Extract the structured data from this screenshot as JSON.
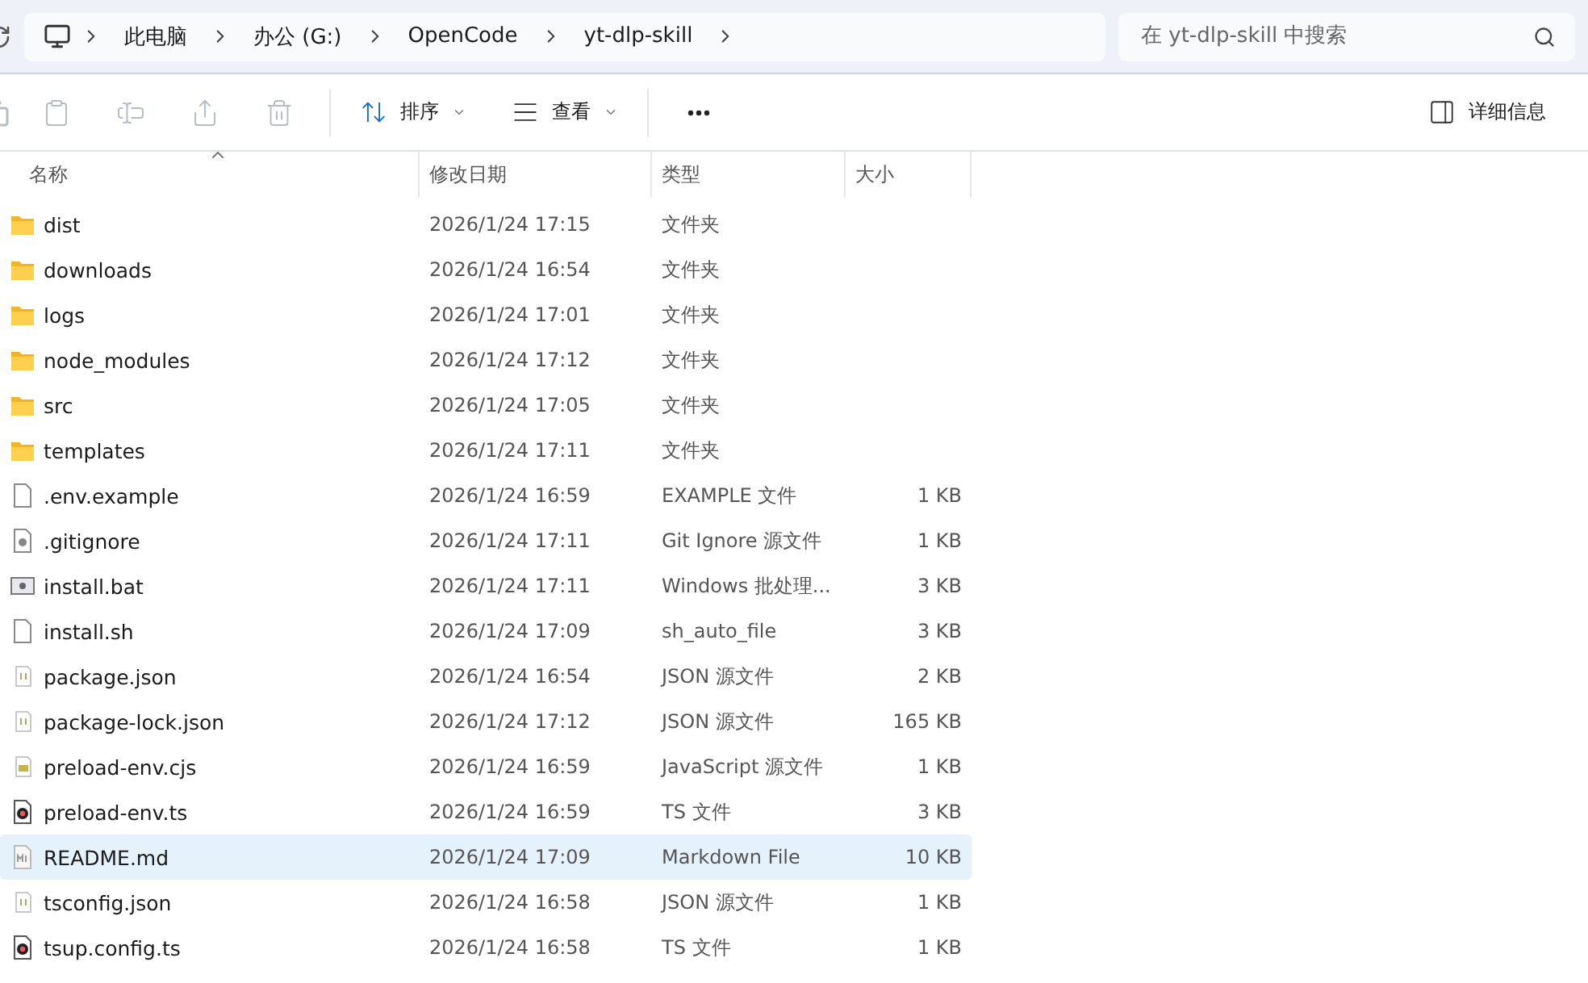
{
  "breadcrumb": [
    "此电脑",
    "办公 (G:)",
    "OpenCode",
    "yt-dlp-skill"
  ],
  "search": {
    "placeholder": "在 yt-dlp-skill 中搜索"
  },
  "toolbar": {
    "actions": [
      {
        "kind": "paste",
        "disabled": true
      },
      {
        "kind": "rename",
        "disabled": true
      },
      {
        "kind": "share",
        "disabled": true
      },
      {
        "kind": "delete",
        "disabled": true
      }
    ],
    "sort": "排序",
    "view": "查看",
    "details": "详细信息"
  },
  "table": {
    "columns": [
      "名称",
      "修改日期",
      "类型",
      "大小"
    ],
    "rows": [
      {
        "kind": "folder",
        "name": "dist",
        "date": "2026/1/24 17:15",
        "type": "文件夹",
        "size": "",
        "selected": false
      },
      {
        "kind": "folder",
        "name": "downloads",
        "date": "2026/1/24 16:54",
        "type": "文件夹",
        "size": "",
        "selected": false
      },
      {
        "kind": "folder",
        "name": "logs",
        "date": "2026/1/24 17:01",
        "type": "文件夹",
        "size": "",
        "selected": false
      },
      {
        "kind": "folder",
        "name": "node_modules",
        "date": "2026/1/24 17:12",
        "type": "文件夹",
        "size": "",
        "selected": false
      },
      {
        "kind": "folder",
        "name": "src",
        "date": "2026/1/24 17:05",
        "type": "文件夹",
        "size": "",
        "selected": false
      },
      {
        "kind": "folder",
        "name": "templates",
        "date": "2026/1/24 17:11",
        "type": "文件夹",
        "size": "",
        "selected": false
      },
      {
        "kind": "file",
        "name": ".env.example",
        "date": "2026/1/24 16:59",
        "type": "EXAMPLE 文件",
        "size": "1 KB",
        "selected": false
      },
      {
        "kind": "config",
        "name": ".gitignore",
        "date": "2026/1/24 17:11",
        "type": "Git Ignore 源文件",
        "size": "1 KB",
        "selected": false
      },
      {
        "kind": "batch",
        "name": "install.bat",
        "date": "2026/1/24 17:11",
        "type": "Windows 批处理...",
        "size": "3 KB",
        "selected": false
      },
      {
        "kind": "file",
        "name": "install.sh",
        "date": "2026/1/24 17:09",
        "type": "sh_auto_file",
        "size": "3 KB",
        "selected": false
      },
      {
        "kind": "json",
        "name": "package.json",
        "date": "2026/1/24 16:54",
        "type": "JSON 源文件",
        "size": "2 KB",
        "selected": false
      },
      {
        "kind": "json",
        "name": "package-lock.json",
        "date": "2026/1/24 17:12",
        "type": "JSON 源文件",
        "size": "165 KB",
        "selected": false
      },
      {
        "kind": "js",
        "name": "preload-env.cjs",
        "date": "2026/1/24 16:59",
        "type": "JavaScript 源文件",
        "size": "1 KB",
        "selected": false
      },
      {
        "kind": "ts",
        "name": "preload-env.ts",
        "date": "2026/1/24 16:59",
        "type": "TS 文件",
        "size": "3 KB",
        "selected": false
      },
      {
        "kind": "markdown",
        "name": "README.md",
        "date": "2026/1/24 17:09",
        "type": "Markdown File",
        "size": "10 KB",
        "selected": true
      },
      {
        "kind": "json",
        "name": "tsconfig.json",
        "date": "2026/1/24 16:58",
        "type": "JSON 源文件",
        "size": "1 KB",
        "selected": false
      },
      {
        "kind": "ts",
        "name": "tsup.config.ts",
        "date": "2026/1/24 16:58",
        "type": "TS 文件",
        "size": "1 KB",
        "selected": false
      }
    ]
  }
}
